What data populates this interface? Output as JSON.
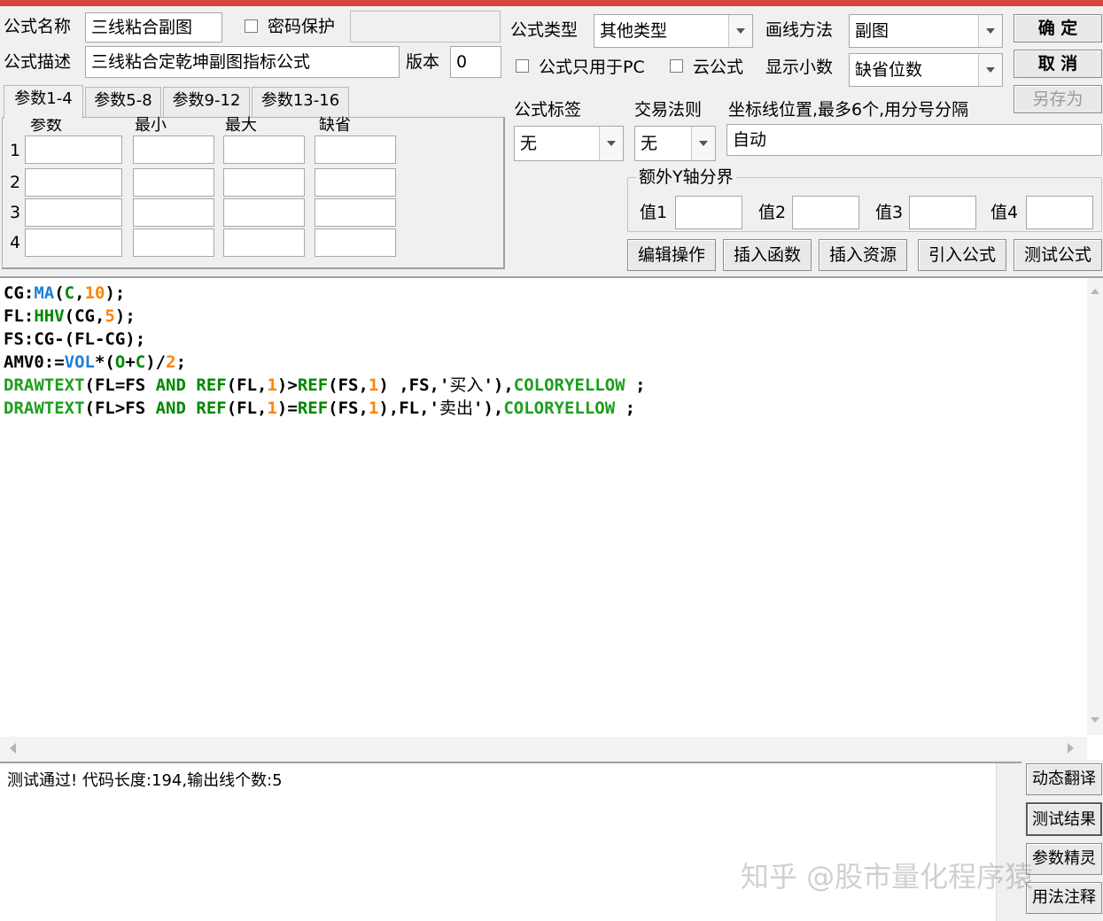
{
  "form": {
    "name_label": "公式名称",
    "name_value": "三线粘合副图",
    "password_label": "密码保护",
    "desc_label": "公式描述",
    "desc_value": "三线粘合定乾坤副图指标公式",
    "version_label": "版本",
    "version_value": "0",
    "type_label": "公式类型",
    "type_value": "其他类型",
    "draw_label": "画线方法",
    "draw_value": "副图",
    "pc_only_label": "公式只用于PC",
    "cloud_label": "云公式",
    "decimal_label": "显示小数",
    "decimal_value": "缺省位数",
    "tag_label": "公式标签",
    "tag_value": "无",
    "trade_label": "交易法则",
    "trade_value": "无",
    "axis_label": "坐标线位置,最多6个,用分号分隔",
    "axis_value": "自动",
    "yaxis_group": "额外Y轴分界",
    "v1": "值1",
    "v2": "值2",
    "v3": "值3",
    "v4": "值4"
  },
  "buttons": {
    "ok": "确 定",
    "cancel": "取 消",
    "saveas": "另存为",
    "edit_ops": "编辑操作",
    "insert_func": "插入函数",
    "insert_res": "插入资源",
    "import_formula": "引入公式",
    "test_formula": "测试公式",
    "dyn_translate": "动态翻译",
    "test_result": "测试结果",
    "param_wizard": "参数精灵",
    "usage_note": "用法注释"
  },
  "tabs": [
    "参数1-4",
    "参数5-8",
    "参数9-12",
    "参数13-16"
  ],
  "params": {
    "headers": [
      "参数",
      "最小",
      "最大",
      "缺省"
    ],
    "rows": [
      "1",
      "2",
      "3",
      "4"
    ]
  },
  "code": {
    "l1": [
      "CG:",
      "MA",
      "(",
      "C",
      ",",
      "10",
      ");"
    ],
    "l2": [
      "FL:",
      "HHV",
      "(CG,",
      "5",
      ");"
    ],
    "l3": [
      "FS:CG-(FL-CG);"
    ],
    "l4": [
      "AMV0:=",
      "VOL",
      "*(",
      "O",
      "+",
      "C",
      ")/",
      "2",
      ";"
    ],
    "l5": [
      "DRAWTEXT",
      "(FL=FS ",
      "AND",
      " ",
      "REF",
      "(FL,",
      "1",
      ")>",
      "REF",
      "(FS,",
      "1",
      ") ,FS,'",
      "买入",
      "'),",
      "COLORYELLOW",
      " ;"
    ],
    "l6": [
      "DRAWTEXT",
      "(FL>FS ",
      "AND",
      " ",
      "REF",
      "(FL,",
      "1",
      ")=",
      "REF",
      "(FS,",
      "1",
      "),FL,'",
      "卖出",
      "'),",
      "COLORYELLOW",
      " ;"
    ]
  },
  "output": {
    "message": "测试通过! 代码长度:194,输出线个数:5"
  },
  "watermark": "知乎 @股市量化程序猿"
}
